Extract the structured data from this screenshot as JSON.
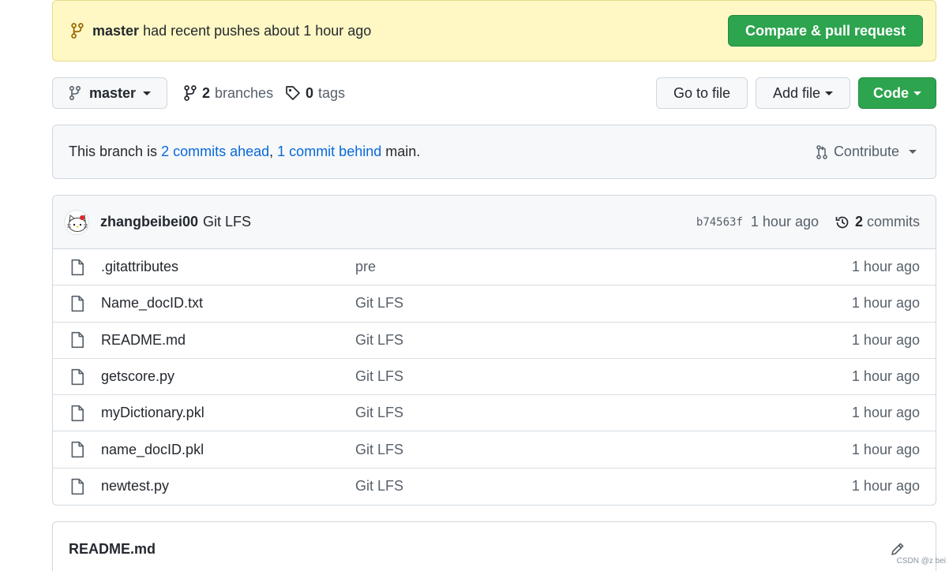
{
  "banner": {
    "branch": "master",
    "message": "had recent pushes about 1 hour ago",
    "compare_button": "Compare & pull request"
  },
  "toolbar": {
    "branch": "master",
    "branches_count": "2",
    "branches_label": "branches",
    "tags_count": "0",
    "tags_label": "tags",
    "go_to_file": "Go to file",
    "add_file": "Add file",
    "code": "Code"
  },
  "comparison": {
    "prefix": "This branch is",
    "ahead": "2 commits ahead",
    "separator": ",",
    "behind": "1 commit behind",
    "suffix": "main.",
    "contribute": "Contribute"
  },
  "latest_commit": {
    "author": "zhangbeibei00",
    "message": "Git LFS",
    "sha": "b74563f",
    "time": "1 hour ago",
    "commits_count": "2",
    "commits_label": "commits"
  },
  "files": [
    {
      "name": ".gitattributes",
      "message": "pre",
      "age": "1 hour ago"
    },
    {
      "name": "Name_docID.txt",
      "message": "Git LFS",
      "age": "1 hour ago"
    },
    {
      "name": "README.md",
      "message": "Git LFS",
      "age": "1 hour ago"
    },
    {
      "name": "getscore.py",
      "message": "Git LFS",
      "age": "1 hour ago"
    },
    {
      "name": "myDictionary.pkl",
      "message": "Git LFS",
      "age": "1 hour ago"
    },
    {
      "name": "name_docID.pkl",
      "message": "Git LFS",
      "age": "1 hour ago"
    },
    {
      "name": "newtest.py",
      "message": "Git LFS",
      "age": "1 hour ago"
    }
  ],
  "readme": {
    "title": "README.md"
  },
  "watermark": "CSDN @z bei",
  "colors": {
    "green": "#2da44e",
    "link": "#0969da",
    "banner_bg": "#fff8c5"
  }
}
